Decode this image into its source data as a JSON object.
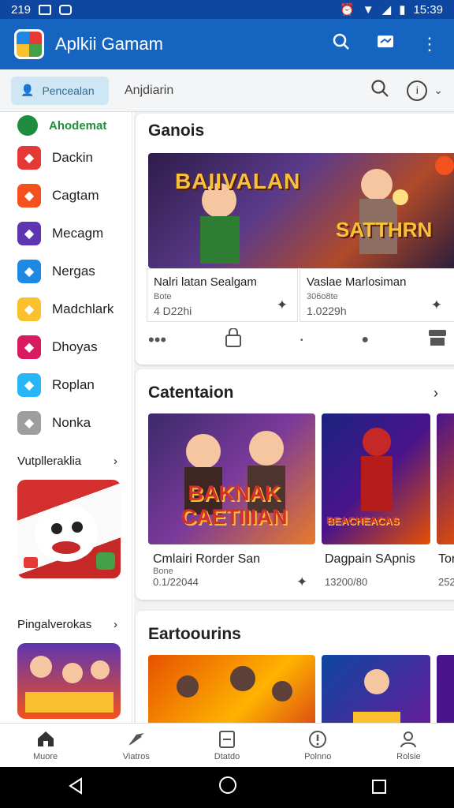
{
  "status": {
    "left_text": "219",
    "time": "15:39"
  },
  "appbar": {
    "title": "Aplkii Gamam",
    "icons": [
      "search-icon",
      "message-icon",
      "more-vert-icon"
    ]
  },
  "toolbar": {
    "chip_label": "Pencealan",
    "title": "Anjdiarin"
  },
  "sidebar": {
    "active_label": "Ahodemat",
    "items": [
      {
        "label": "Dackin",
        "color": "#e53935"
      },
      {
        "label": "Cagtam",
        "color": "#f4511e"
      },
      {
        "label": "Mecagm",
        "color": "#5e35b1"
      },
      {
        "label": "Nergas",
        "color": "#1e88e5"
      },
      {
        "label": "Madchlark",
        "color": "#fbc02d"
      },
      {
        "label": "Dhoyas",
        "color": "#d81b60"
      },
      {
        "label": "Roplan",
        "color": "#29b6f6"
      },
      {
        "label": "Nonka",
        "color": "#9e9e9e"
      }
    ],
    "section1": "Vutplleraklia",
    "section2": "Pingalverokas"
  },
  "main": {
    "games": {
      "title": "Ganois",
      "hero_text_left": "BAIIVALAN",
      "hero_text_right": "SATTHRN",
      "items": [
        {
          "name": "Nalri latan Sealgam",
          "sub": "Bote",
          "size": "4 D22hi"
        },
        {
          "name": "Vaslae Marlosiman",
          "sub": "306o8te",
          "size": "1.0229h"
        }
      ]
    },
    "categories": {
      "title": "Catentaion",
      "items": [
        {
          "name": "Cmlairi Rorder San",
          "sub": "Bone",
          "size": "0.1/22044",
          "art": "BAKNAK CAETIIIAN"
        },
        {
          "name": "Dagpain SApnis",
          "sub": "",
          "size": "13200/80",
          "art": "BEACHEACAS"
        },
        {
          "name": "Tor",
          "sub": "",
          "size": "252",
          "art": ""
        }
      ]
    },
    "third": {
      "title": "Eartoourins"
    }
  },
  "bottom_nav": [
    {
      "label": "Muore",
      "icon": "home-icon"
    },
    {
      "label": "Viatros",
      "icon": "send-icon"
    },
    {
      "label": "Dtatdo",
      "icon": "document-icon"
    },
    {
      "label": "Polnno",
      "icon": "info-icon"
    },
    {
      "label": "Rolsie",
      "icon": "profile-icon"
    }
  ]
}
